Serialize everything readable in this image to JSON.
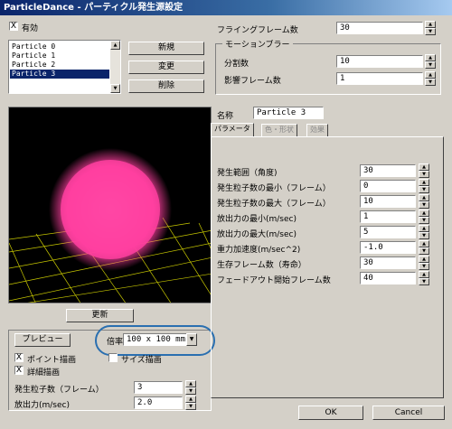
{
  "window": {
    "title": "ParticleDance - パーティクル発生源設定"
  },
  "enabled": {
    "label": "有効",
    "checked": "X"
  },
  "particle_list": {
    "items": [
      "Particle 0",
      "Particle 1",
      "Particle 2",
      "Particle 3"
    ],
    "selected_index": 3
  },
  "list_buttons": {
    "new": "新規",
    "change": "変更",
    "delete": "削除"
  },
  "flying": {
    "label": "フライングフレーム数",
    "value": "30"
  },
  "motion_blur": {
    "title": "モーションブラー",
    "divisions_label": "分割数",
    "divisions_value": "10",
    "affect_label": "影響フレーム数",
    "affect_value": "1"
  },
  "update_button": "更新",
  "name": {
    "label": "名称",
    "value": "Particle 3"
  },
  "tabs": [
    "パラメータ",
    "色・形状",
    "効果"
  ],
  "params": [
    {
      "label": "発生範囲（角度)",
      "value": "30"
    },
    {
      "label": "発生粒子数の最小（フレーム）",
      "value": "0"
    },
    {
      "label": "発生粒子数の最大（フレーム）",
      "value": "10"
    },
    {
      "label": "放出力の最小(m/sec)",
      "value": "1"
    },
    {
      "label": "放出力の最大(m/sec)",
      "value": "5"
    },
    {
      "label": "重力加速度(m/sec^2)",
      "value": "-1.0"
    },
    {
      "label": "生存フレーム数（寿命）",
      "value": "30"
    },
    {
      "label": "フェードアウト開始フレーム数",
      "value": "40"
    }
  ],
  "preview": {
    "button": "プレビュー",
    "scale_label": "倍率",
    "scale_value": "100 x 100 mm",
    "size_label": "サイズ描画",
    "point_label": "ポイント描画",
    "detail_label": "詳細描画",
    "check": "X"
  },
  "bottom_fields": {
    "count_label": "発生粒子数（フレーム）",
    "count_value": "3",
    "force_label": "放出力(m/sec)",
    "force_value": "2.0"
  },
  "ok": "OK",
  "cancel": "Cancel",
  "colors": {
    "particle": "#ff3fa0",
    "grid": "#d6d600",
    "annotation": "#2a6fb0"
  }
}
